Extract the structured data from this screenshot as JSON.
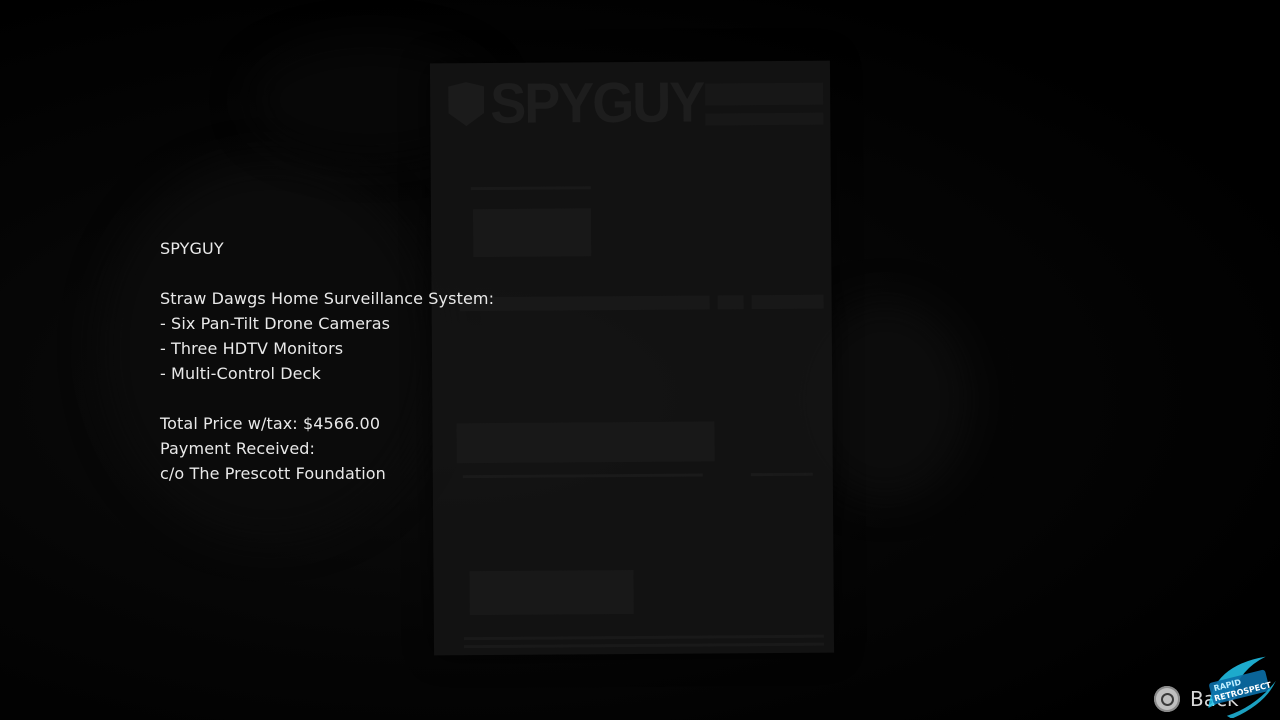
{
  "document": {
    "logo_text": "SPYGUY"
  },
  "readout": {
    "vendor": "SPYGUY",
    "product_title": "Straw Dawgs Home Surveillance System:",
    "items": [
      "- Six Pan-Tilt Drone Cameras",
      "- Three HDTV Monitors",
      "- Multi-Control Deck"
    ],
    "total_price": "Total Price w/tax: $4566.00",
    "payment_status": "Payment Received:",
    "payer": "c/o The Prescott Foundation"
  },
  "controls": {
    "back_label": "Back",
    "back_button_icon": "circle-button-icon"
  },
  "watermark": {
    "text_top": "RAPID",
    "text_bottom": "RETROSPECT",
    "color": "#22c8f0"
  },
  "colors": {
    "text": "#e9e9e9",
    "background": "#000000",
    "watermark_accent": "#22c8f0"
  }
}
